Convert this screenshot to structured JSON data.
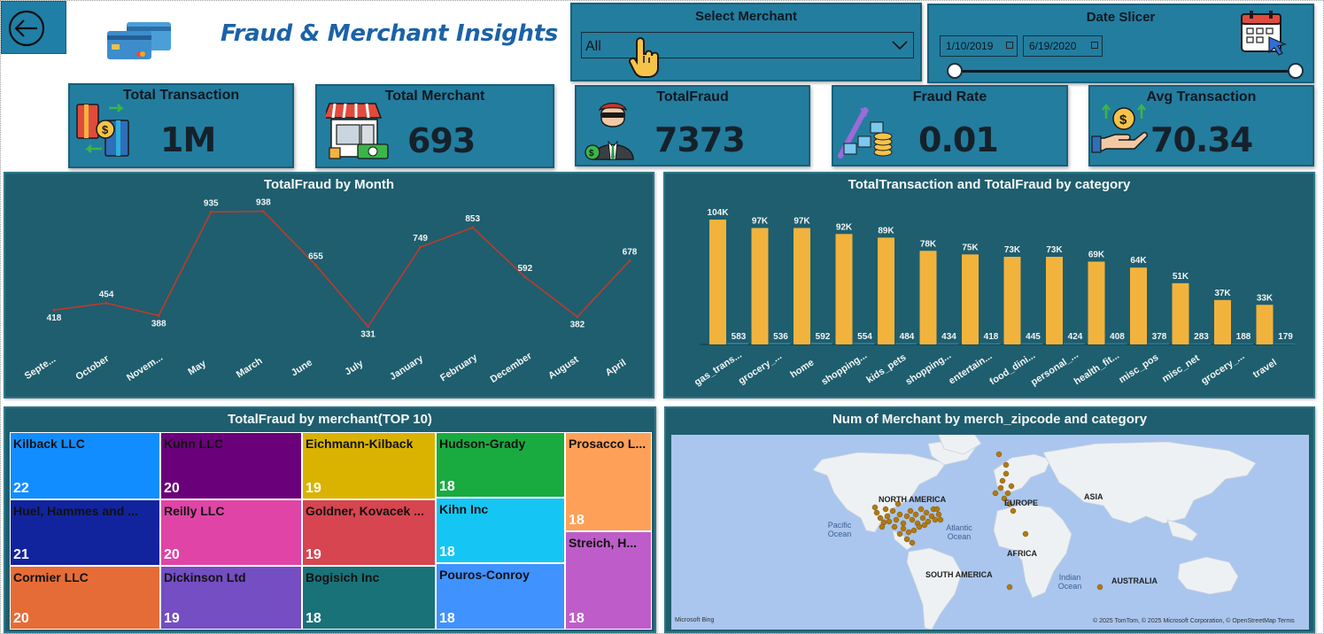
{
  "header": {
    "title": "Fraud & Merchant Insights"
  },
  "merchant_slicer": {
    "title": "Select Merchant",
    "value": "All"
  },
  "date_slicer": {
    "title": "Date Slicer",
    "start": "1/10/2019",
    "end": "6/19/2020"
  },
  "kpis": {
    "total_transaction": {
      "label": "Total Transaction",
      "value": "1M"
    },
    "total_merchant": {
      "label": "Total Merchant",
      "value": "693"
    },
    "total_fraud": {
      "label": "TotalFraud",
      "value": "7373"
    },
    "fraud_rate": {
      "label": "Fraud Rate",
      "value": "0.01"
    },
    "avg_transaction": {
      "label": "Avg Transaction",
      "value": "70.34"
    }
  },
  "line_panel": {
    "title": "TotalFraud by Month"
  },
  "bar_panel": {
    "title": "TotalTransaction and TotalFraud by category"
  },
  "treemap_panel": {
    "title": "TotalFraud by merchant(TOP 10)"
  },
  "map_panel": {
    "title": "Num of Merchant by merch_zipcode and category",
    "labels": {
      "north_america": "NORTH AMERICA",
      "europe": "EUROPE",
      "asia": "ASIA",
      "africa": "AFRICA",
      "south_america": "SOUTH AMERICA",
      "australia": "AUSTRALIA",
      "pacific": "Pacific Ocean",
      "atlantic": "Atlantic Ocean",
      "indian": "Indian Ocean"
    },
    "brand": "Microsoft Bing",
    "attribution": "© 2025 TomTom, © 2025 Microsoft Corporation, © OpenStreetMap  Terms",
    "dot_color": "#b07a10"
  },
  "chart_data": [
    {
      "type": "line",
      "title": "TotalFraud by Month",
      "categories": [
        "Septe...",
        "October",
        "Novem...",
        "May",
        "March",
        "June",
        "July",
        "January",
        "February",
        "December",
        "August",
        "April"
      ],
      "values": [
        418,
        454,
        388,
        935,
        938,
        655,
        331,
        749,
        853,
        592,
        382,
        678
      ],
      "value_labels": [
        "418",
        "454",
        "388",
        "935",
        "938",
        "655",
        "331",
        "749",
        "853",
        "592",
        "382",
        "678"
      ],
      "line_color": "#c0392b"
    },
    {
      "type": "bar",
      "title": "TotalTransaction and TotalFraud by category",
      "categories": [
        "gas_trans...",
        "grocery_...",
        "home",
        "shopping...",
        "kids_pets",
        "shopping...",
        "entertain...",
        "food_dini...",
        "personal_...",
        "health_fit...",
        "misc_pos",
        "misc_net",
        "grocery_...",
        "travel"
      ],
      "series": [
        {
          "values": [
            104000,
            97000,
            97000,
            92000,
            89000,
            78000,
            75000,
            73000,
            73000,
            69000,
            64000,
            51000,
            37000,
            33000
          ],
          "labels": [
            "104K",
            "97K",
            "97K",
            "92K",
            "89K",
            "78K",
            "75K",
            "73K",
            "73K",
            "69K",
            "64K",
            "51K",
            "37K",
            "33K"
          ],
          "color": "#f2b33d"
        },
        {
          "values": [
            583,
            536,
            592,
            554,
            484,
            434,
            418,
            445,
            424,
            408,
            378,
            283,
            188,
            179
          ],
          "labels": [
            "583",
            "536",
            "592",
            "554",
            "484",
            "434",
            "418",
            "445",
            "424",
            "408",
            "378",
            "283",
            "188",
            "179"
          ],
          "color": "#2c7da0"
        }
      ]
    },
    {
      "type": "treemap",
      "title": "TotalFraud by merchant(TOP 10)",
      "items": [
        {
          "name": "Kilback LLC",
          "value": "22",
          "color": "#118dff"
        },
        {
          "name": "Huel, Hammes and ...",
          "value": "21",
          "color": "#12239e"
        },
        {
          "name": "Cormier LLC",
          "value": "20",
          "color": "#e66c37"
        },
        {
          "name": "Kuhn LLC",
          "value": "20",
          "color": "#6b007b"
        },
        {
          "name": "Reilly LLC",
          "value": "20",
          "color": "#e044a7"
        },
        {
          "name": "Dickinson Ltd",
          "value": "19",
          "color": "#744ec2"
        },
        {
          "name": "Eichmann-Kilback",
          "value": "19",
          "color": "#d9b300"
        },
        {
          "name": "Goldner, Kovacek ...",
          "value": "19",
          "color": "#d64550"
        },
        {
          "name": "Bogisich Inc",
          "value": "18",
          "color": "#197278"
        },
        {
          "name": "Hudson-Grady",
          "value": "18",
          "color": "#1aab40"
        },
        {
          "name": "Kihn Inc",
          "value": "18",
          "color": "#15c6f4"
        },
        {
          "name": "Pouros-Conroy",
          "value": "18",
          "color": "#4092ff"
        },
        {
          "name": "Prosacco L...",
          "value": "18",
          "color": "#ffa058"
        },
        {
          "name": "Streich, H...",
          "value": "18",
          "color": "#be5dc9"
        }
      ]
    }
  ]
}
